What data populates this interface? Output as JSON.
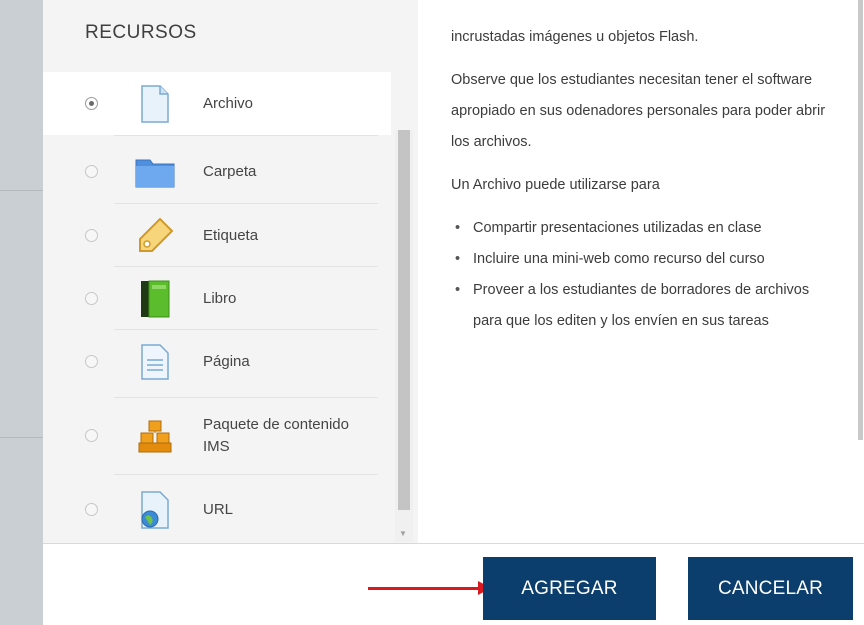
{
  "panel": {
    "title": "RECURSOS",
    "modules": [
      {
        "label": "Archivo",
        "icon": "file-icon",
        "selected": true
      },
      {
        "label": "Carpeta",
        "icon": "folder-icon",
        "selected": false
      },
      {
        "label": "Etiqueta",
        "icon": "tag-icon",
        "selected": false
      },
      {
        "label": "Libro",
        "icon": "book-icon",
        "selected": false
      },
      {
        "label": "Página",
        "icon": "page-icon",
        "selected": false
      },
      {
        "label": "Paquete de contenido IMS",
        "icon": "ims-package-icon",
        "selected": false
      },
      {
        "label": "URL",
        "icon": "url-icon",
        "selected": false
      }
    ]
  },
  "help": {
    "intro": "incrustadas imágenes u objetos Flash.",
    "note": "Observe que los estudiantes necesitan tener el software apropiado en sus odenadores personales para poder abrir los archivos.",
    "uses_title": "Un Archivo puede utilizarse para",
    "uses": [
      "Compartir presentaciones utilizadas en clase",
      "Incluire una mini-web como recurso del curso",
      "Proveer a los estudiantes de borradores de archivos para que los editen y los envíen en sus tareas"
    ]
  },
  "footer": {
    "add_label": "AGREGAR",
    "cancel_label": "CANCELAR"
  },
  "colors": {
    "button_bg": "#0c3e6d",
    "annotation_arrow": "#d9181f"
  }
}
